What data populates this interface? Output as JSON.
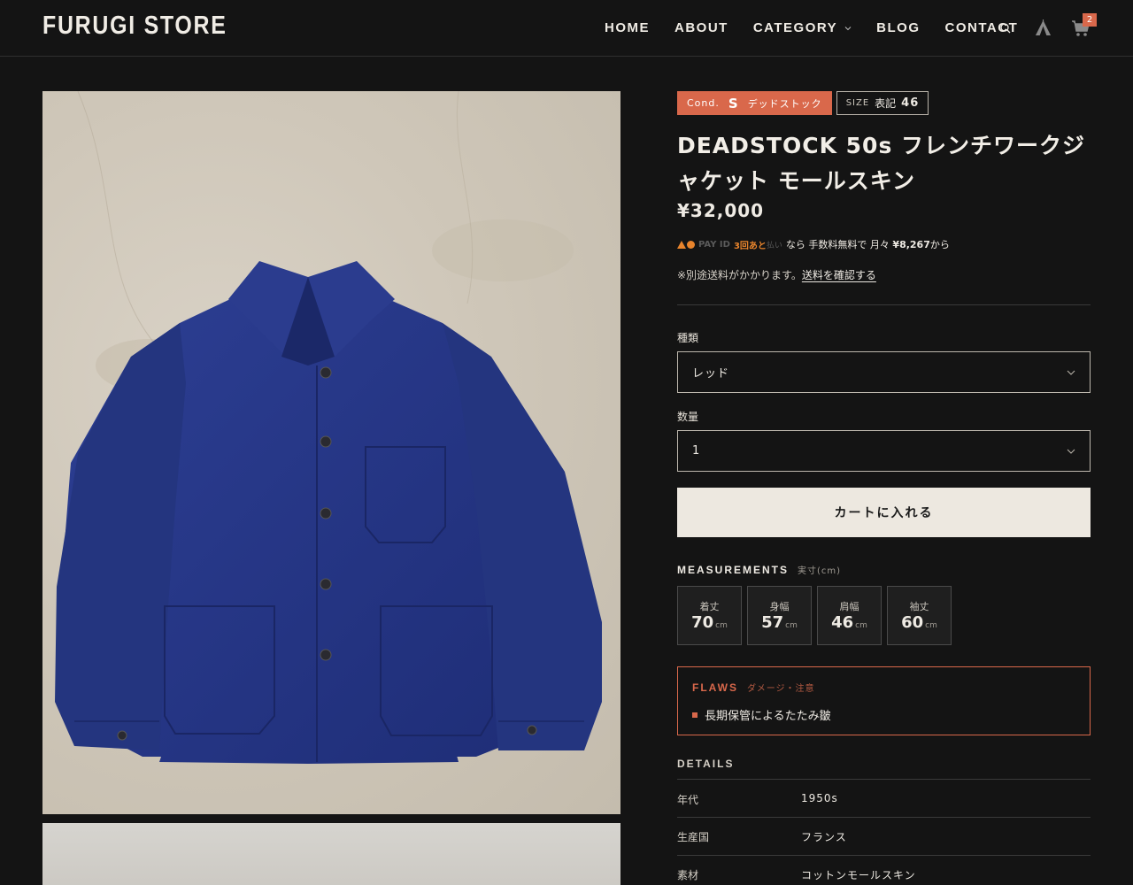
{
  "header": {
    "logo": "FURUGI STORE",
    "nav": [
      "HOME",
      "ABOUT",
      "CATEGORY",
      "BLOG",
      "CONTACT"
    ],
    "cart_count": "2"
  },
  "product": {
    "condition_label": "Cond.",
    "condition_grade": "S",
    "condition_text": "デッドストック",
    "size_label": "SIZE",
    "size_prefix": "表記",
    "size_value": "46",
    "title": "DEADSTOCK 50s フレンチワークジャケット モールスキン",
    "price": "¥32,000",
    "payid": {
      "brand": "PAY ID",
      "times": "3回あと",
      "small": "払い",
      "text_prefix": "なら 手数料無料で 月々",
      "amount": "¥8,267",
      "text_suffix": "から"
    },
    "shipping_note": "※別途送料がかかります。",
    "shipping_link": "送料を確認する"
  },
  "form": {
    "variant_label": "種類",
    "variant_value": "レッド",
    "qty_label": "数量",
    "qty_value": "1",
    "cart_button": "カートに入れる"
  },
  "measurements": {
    "title": "MEASUREMENTS",
    "subtitle": "実寸(cm)",
    "unit": "cm",
    "items": [
      {
        "label": "着丈",
        "value": "70"
      },
      {
        "label": "身幅",
        "value": "57"
      },
      {
        "label": "肩幅",
        "value": "46"
      },
      {
        "label": "袖丈",
        "value": "60"
      }
    ]
  },
  "flaws": {
    "title": "FLAWS",
    "subtitle": "ダメージ・注意",
    "items": [
      "長期保管によるたたみ皺"
    ]
  },
  "details": {
    "title": "DETAILS",
    "rows": [
      {
        "label": "年代",
        "value": "1950s"
      },
      {
        "label": "生産国",
        "value": "フランス"
      },
      {
        "label": "素材",
        "value": "コットンモールスキン"
      }
    ]
  },
  "colors": {
    "background": "#141414",
    "accent": "#d9684b",
    "button_bg": "#ede8e0",
    "jacket": "#26378a"
  }
}
